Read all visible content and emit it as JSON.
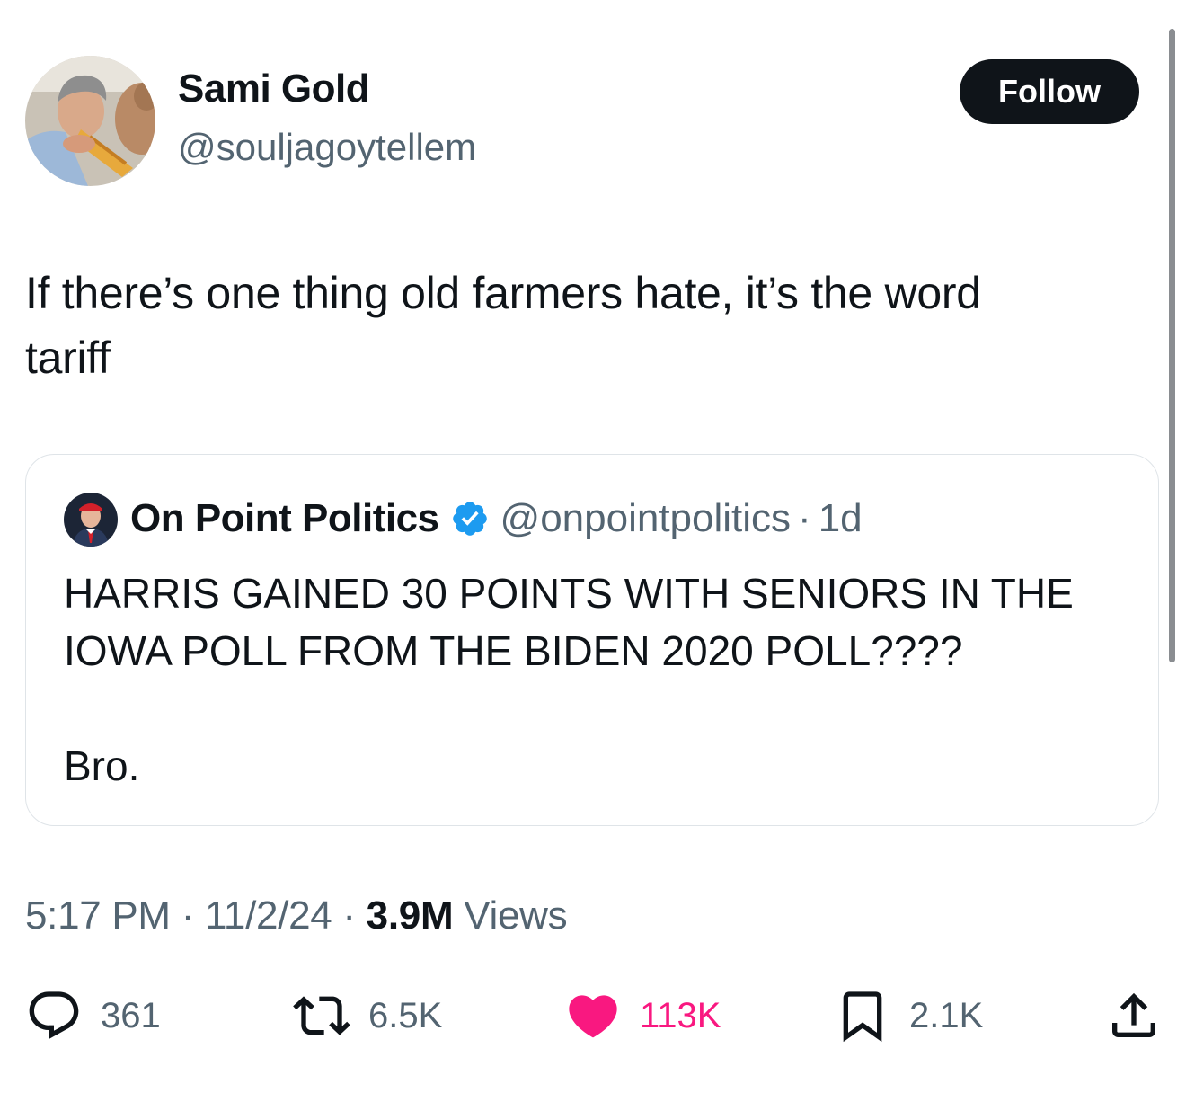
{
  "author": {
    "name": "Sami Gold",
    "handle": "@souljagoytellem",
    "avatar_icon": "profile-photo"
  },
  "follow_button": {
    "label": "Follow"
  },
  "tweet": {
    "line1": "If there’s one thing old farmers hate, it’s the word",
    "line2": "tariff"
  },
  "quote": {
    "name": "On Point Politics",
    "verified_icon": "verified-badge-icon",
    "handle": "@onpointpolitics",
    "separator": "·",
    "time": "1d",
    "text": "HARRIS GAINED 30 POINTS WITH SENIORS IN THE IOWA POLL FROM THE BIDEN 2020 POLL????",
    "text2": "Bro."
  },
  "meta": {
    "time": "5:17 PM",
    "separator": "·",
    "date": "11/2/24",
    "views_count": "3.9M",
    "views_label": "Views"
  },
  "actions": {
    "replies": "361",
    "reposts": "6.5K",
    "likes": "113K",
    "bookmarks": "2.1K"
  },
  "colors": {
    "text_primary": "#0f1419",
    "text_secondary": "#536471",
    "like_pink": "#f91880",
    "verified_blue": "#1d9bf0",
    "border": "#dfe4e8"
  }
}
